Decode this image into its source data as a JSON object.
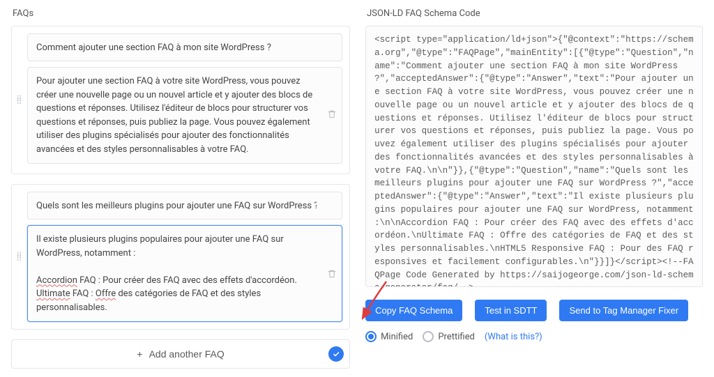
{
  "left": {
    "title": "FAQs",
    "faqs": [
      {
        "question": "Comment ajouter une section FAQ à mon site WordPress ?",
        "answer": "Pour ajouter une section FAQ à votre site WordPress, vous pouvez créer une nouvelle page ou un nouvel article et y ajouter des blocs de questions et réponses. Utilisez l'éditeur de blocs pour structurer vos questions et réponses, puis publiez la page. Vous pouvez également utiliser des plugins spécialisés pour ajouter des fonctionnalités avancées et des styles personnalisables à votre FAQ."
      },
      {
        "question": "Quels sont les meilleurs plugins pour ajouter une FAQ sur WordPress ?",
        "answer_html": "Il existe plusieurs plugins populaires pour ajouter une FAQ sur WordPress, notamment :\n\nAccordion FAQ : Pour créer des FAQ avec des effets d'accordéon.\nUltimate FAQ : Offre des catégories de FAQ et des styles personnalisables."
      }
    ],
    "add_label": "Add another FAQ"
  },
  "right": {
    "title": "JSON-LD FAQ Schema Code",
    "code": "<script type=\"application/ld+json\">{\"@context\":\"https://schema.org\",\"@type\":\"FAQPage\",\"mainEntity\":[{\"@type\":\"Question\",\"name\":\"Comment ajouter une section FAQ à mon site WordPress ?\",\"acceptedAnswer\":{\"@type\":\"Answer\",\"text\":\"Pour ajouter une section FAQ à votre site WordPress, vous pouvez créer une nouvelle page ou un nouvel article et y ajouter des blocs de questions et réponses. Utilisez l'éditeur de blocs pour structurer vos questions et réponses, puis publiez la page. Vous pouvez également utiliser des plugins spécialisés pour ajouter des fonctionnalités avancées et des styles personnalisables à votre FAQ.\\n\\n\"}},{\"@type\":\"Question\",\"name\":\"Quels sont les meilleurs plugins pour ajouter une FAQ sur WordPress ?\",\"acceptedAnswer\":{\"@type\":\"Answer\",\"text\":\"Il existe plusieurs plugins populaires pour ajouter une FAQ sur WordPress, notamment :\\n\\nAccordion FAQ : Pour créer des FAQ avec des effets d'accordéon.\\nUltimate FAQ : Offre des catégories de FAQ et des styles personnalisables.\\nHTML5 Responsive FAQ : Pour des FAQ responsives et facilement configurables.\\n\"}}]}</script><!--FAQPage Code Generated by https://saijogeorge.com/json-ld-schema-generator/faq/-->",
    "buttons": {
      "copy": "Copy FAQ Schema",
      "test": "Test in SDTT",
      "send": "Send to Tag Manager Fixer"
    },
    "radios": {
      "minified": "Minified",
      "prettified": "Prettified",
      "selected": "minified",
      "help": "(What is this?)"
    }
  }
}
